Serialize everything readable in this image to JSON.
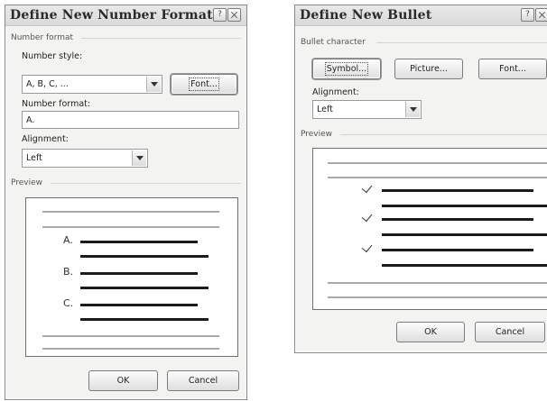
{
  "number_dialog": {
    "title": "Define New Number Format",
    "section_number_format": "Number format",
    "number_style_label": "Number style:",
    "number_style_value": "A, B, C, ...",
    "font_button": "Font...",
    "number_format_label": "Number format:",
    "number_format_value": "A.",
    "alignment_label": "Alignment:",
    "alignment_value": "Left",
    "section_preview": "Preview",
    "preview_markers": [
      "A.",
      "B.",
      "C."
    ],
    "ok_button": "OK",
    "cancel_button": "Cancel"
  },
  "bullet_dialog": {
    "title": "Define New Bullet",
    "section_bullet_character": "Bullet character",
    "symbol_button": "Symbol...",
    "picture_button": "Picture...",
    "font_button": "Font...",
    "alignment_label": "Alignment:",
    "alignment_value": "Left",
    "section_preview": "Preview",
    "bullet_icon": "checkmark-icon",
    "ok_button": "OK",
    "cancel_button": "Cancel"
  }
}
